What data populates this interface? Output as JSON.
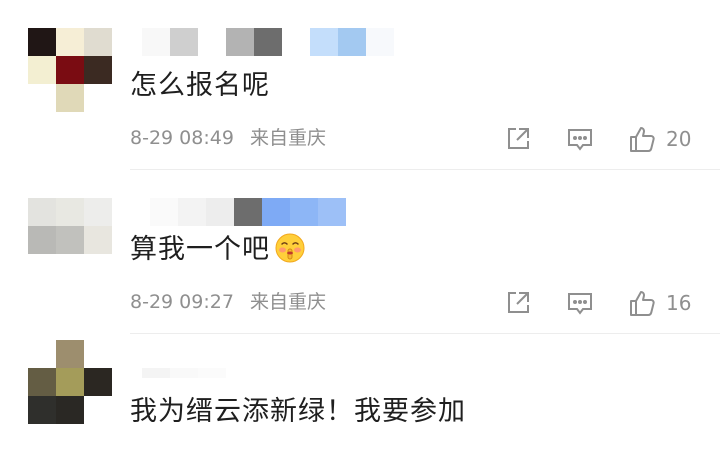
{
  "comments": [
    {
      "text": "怎么报名呢",
      "date": "8-29",
      "time": "08:49",
      "location": "来自重庆",
      "likes": "20",
      "avatar_colors": [
        "#201615",
        "#f6eed6",
        "#e0dcd0",
        "#f3efd2",
        "#7a0c12",
        "#3b2a22",
        "#ffffff",
        "#e0d9b8",
        "#ffffff"
      ],
      "name_blocks": [
        "#f8f8f8",
        "#cfcfcf",
        "#ffffff",
        "#b3b3b3",
        "#6d6d6d",
        "#ffffff",
        "#c4defb",
        "#a3c9f1",
        "#f7f9fc"
      ]
    },
    {
      "text": "算我一个吧",
      "date": "8-29",
      "time": "09:27",
      "location": "来自重庆",
      "likes": "16",
      "avatar_colors": [
        "#e3e3df",
        "#e8e8e2",
        "#ededeb",
        "#b9b9b6",
        "#c1c1bd",
        "#e8e6df",
        "#ffffff",
        "#ffffff",
        "#ffffff"
      ],
      "name_blocks": [
        "#fafafa",
        "#f3f3f3",
        "#ededed",
        "#6d6d6d",
        "#7eaaf5",
        "#8db6f6",
        "#9dc0f7"
      ]
    },
    {
      "text": "我为缙云添新绿！我要参加",
      "avatar_colors": [
        "#ffffff",
        "#9d8e6e",
        "#ffffff",
        "#645d44",
        "#a49c5a",
        "#2b2722",
        "#2f2f2c",
        "#2a2824",
        "#ffffff"
      ],
      "name_blocks": [
        "#f4f4f4",
        "#f9f9f9",
        "#fbfbfb"
      ]
    }
  ],
  "icons": {
    "share": "share-icon",
    "comment": "comment-icon",
    "like": "like-icon",
    "emoji": "shushing-face-emoji-icon"
  },
  "colors": {
    "text": "#1f1f1f",
    "meta": "#8f8f8f",
    "divider": "#ededed"
  }
}
